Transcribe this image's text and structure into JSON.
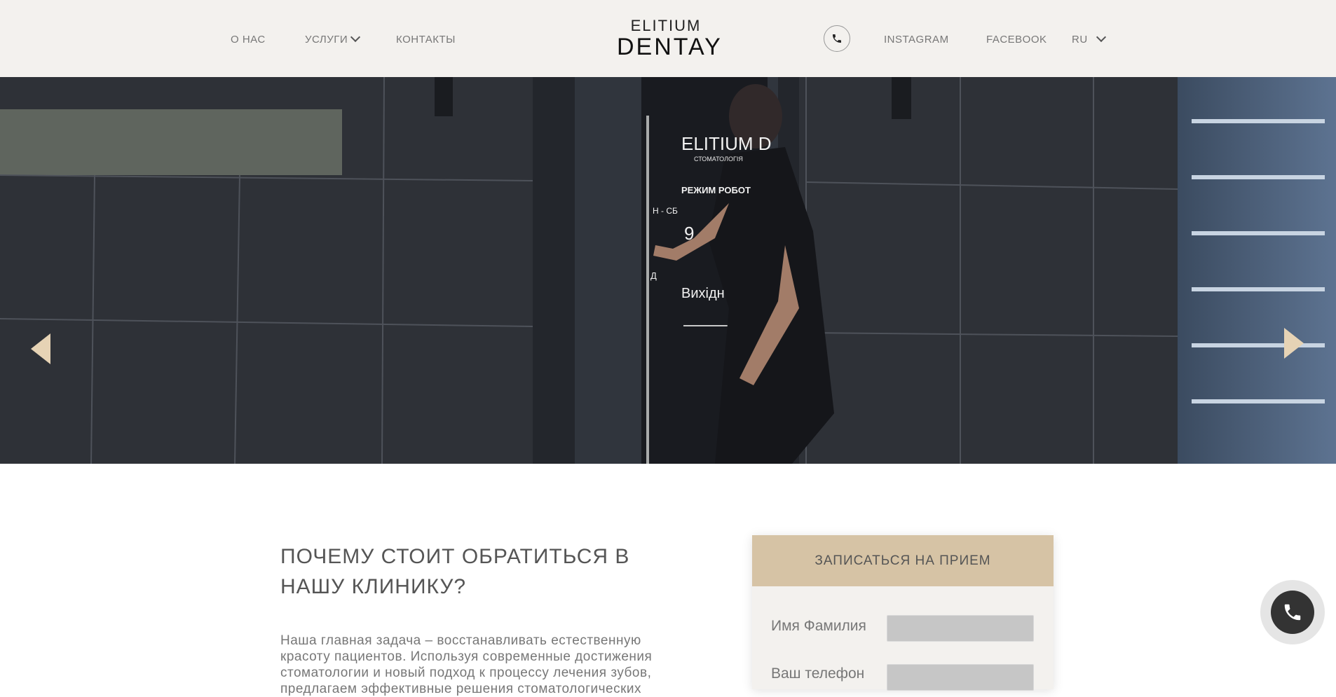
{
  "header": {
    "nav": [
      "О НАС",
      "УСЛУГИ",
      "КОНТАКТЫ"
    ],
    "logo_top": "ELITIUM",
    "logo_main": "DENTAY",
    "social": [
      "INSTAGRAM",
      "FACEBOOK"
    ],
    "language": "RU"
  },
  "hero": {
    "door_sign": {
      "brand": "ELITIUM D",
      "subtitle": "СТОМАТОЛОГІЯ",
      "hours_title": "РЕЖИМ РОБОТ",
      "days": "Н - СБ",
      "time": "9",
      "dayoff_letter": "Д",
      "dayoff": "Вихідн"
    }
  },
  "about": {
    "title": "ПОЧЕМУ СТОИТ ОБРАТИТЬСЯ В НАШУ КЛИНИКУ?",
    "text": "Наша главная задача – восстанавливать естественную красоту пациентов. Используя современные достижения стоматологии и новый подход к процессу лечения зубов, предлагаем эффективные решения стоматологических"
  },
  "form": {
    "title": "ЗАПИСАТЬСЯ НА ПРИЕМ",
    "name_label": "Имя Фамилия",
    "phone_label": "Ваш телефон"
  },
  "colors": {
    "header_bg": "#f3f1ee",
    "accent": "#d6c3a5",
    "arrow": "#e6d3b5"
  }
}
